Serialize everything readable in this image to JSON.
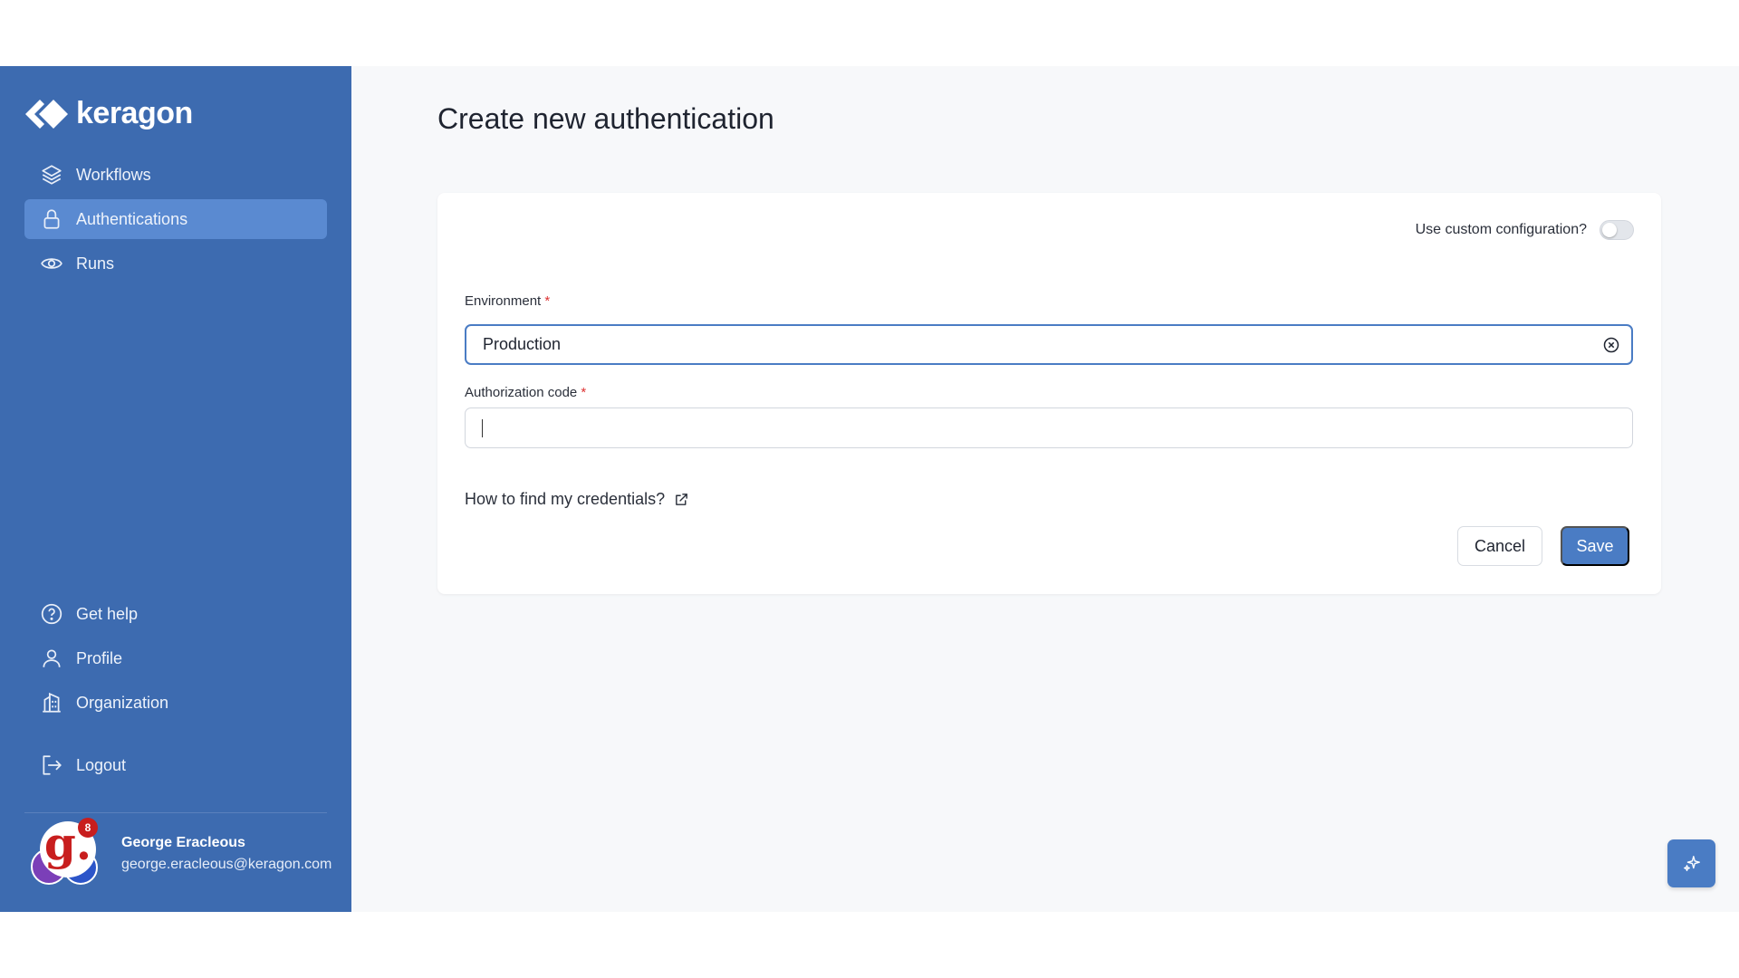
{
  "brand": {
    "name": "keragon"
  },
  "sidebar": {
    "top_items": [
      {
        "label": "Workflows",
        "icon": "layers-icon",
        "active": false
      },
      {
        "label": "Authentications",
        "icon": "lock-icon",
        "active": true
      },
      {
        "label": "Runs",
        "icon": "eye-icon",
        "active": false
      }
    ],
    "bottom_items": [
      {
        "label": "Get help",
        "icon": "help-circle-icon"
      },
      {
        "label": "Profile",
        "icon": "user-icon"
      },
      {
        "label": "Organization",
        "icon": "building-icon"
      }
    ],
    "logout_label": "Logout"
  },
  "user": {
    "name": "George Eracleous",
    "email": "george.eracleous@keragon.com",
    "avatar_letter": "g.",
    "notification_count": "8"
  },
  "page": {
    "title": "Create new authentication"
  },
  "form": {
    "custom_config_label": "Use custom configuration?",
    "custom_config_on": false,
    "environment_label": "Environment",
    "environment_value": "Production",
    "auth_code_label": "Authorization code",
    "auth_code_value": "",
    "required_marker": "*",
    "help_link": "How to find my credentials?",
    "cancel_label": "Cancel",
    "save_label": "Save"
  },
  "colors": {
    "sidebar_bg": "#3d6bb0",
    "sidebar_active": "#5a8ad1",
    "accent": "#4a7cc4",
    "required": "#dd3333"
  }
}
